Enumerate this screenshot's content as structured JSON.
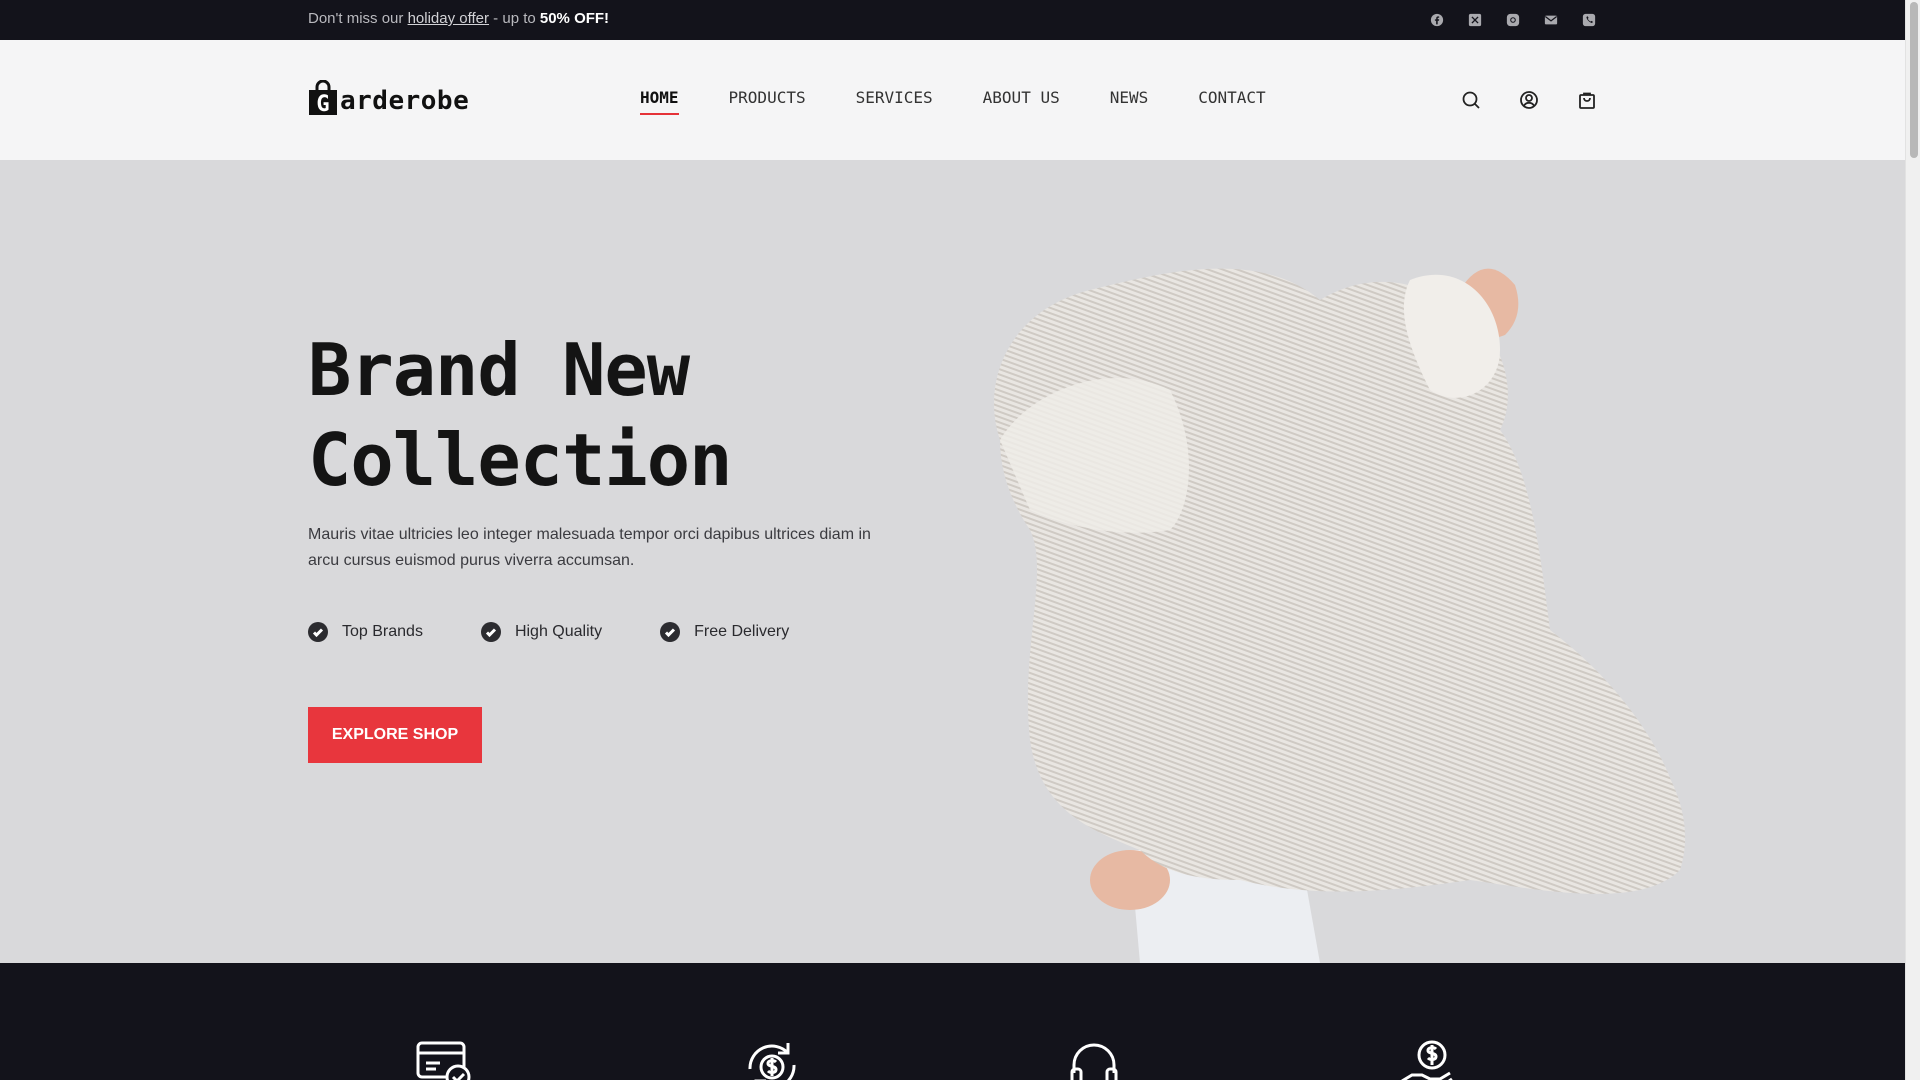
{
  "topbar": {
    "promo_prefix": "Don't miss our ",
    "promo_link": "holiday offer",
    "promo_mid": " - up to ",
    "promo_bold": "50% OFF!",
    "social_icons": [
      "facebook-icon",
      "x-icon",
      "instagram-icon",
      "mail-icon",
      "phone-icon"
    ]
  },
  "header": {
    "logo_letter": "G",
    "logo_text": "arderobe",
    "nav": [
      {
        "label": "HOME",
        "active": true
      },
      {
        "label": "PRODUCTS"
      },
      {
        "label": "SERVICES"
      },
      {
        "label": "ABOUT US"
      },
      {
        "label": "NEWS"
      },
      {
        "label": "CONTACT"
      }
    ],
    "icons": [
      "search-icon",
      "user-icon",
      "cart-icon"
    ]
  },
  "hero": {
    "title_line1": "Brand New",
    "title_line2": "Collection",
    "description": "Mauris vitae ultricies leo integer malesuada tempor orci dapibus ultrices diam in arcu cursus euismod purus viverra accumsan.",
    "features": [
      "Top Brands",
      "High Quality",
      "Free Delivery"
    ],
    "cta_label": "EXPLORE SHOP"
  },
  "band": {
    "icons": [
      "payment-card-icon",
      "money-return-icon",
      "headset-support-icon",
      "hand-money-icon"
    ]
  },
  "colors": {
    "accent": "#e8363d",
    "dark": "#13131b",
    "hero_bg": "#d9d9db"
  }
}
